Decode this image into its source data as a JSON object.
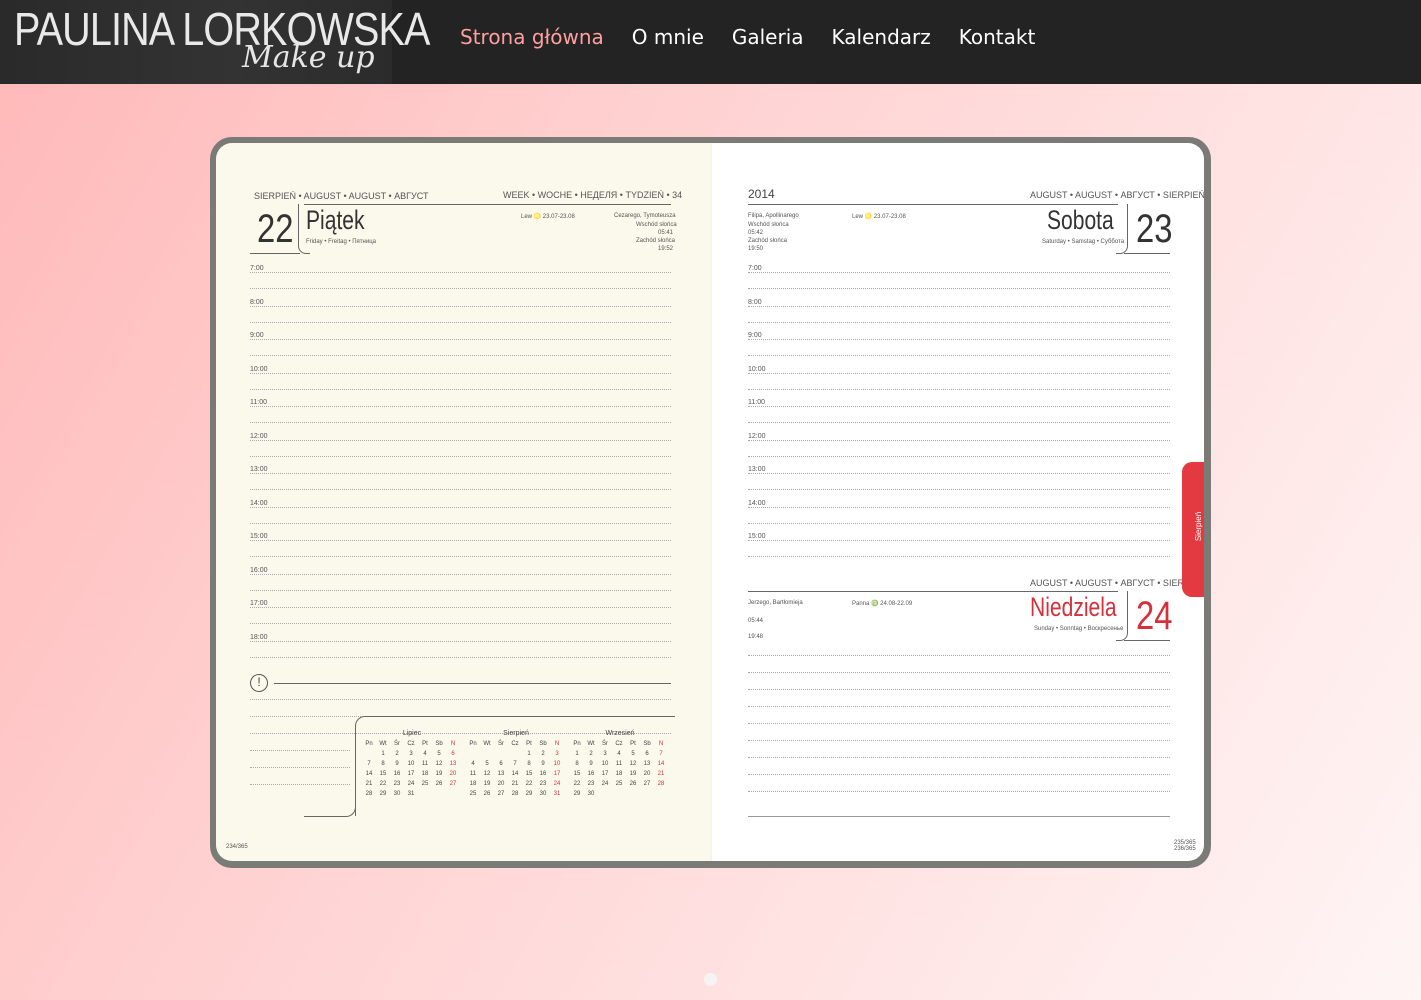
{
  "header": {
    "logo_name": "PAULINA LORKOWSKA",
    "logo_sub": "Make up",
    "nav": [
      {
        "label": "Strona główna",
        "active": true
      },
      {
        "label": "O mnie"
      },
      {
        "label": "Galeria"
      },
      {
        "label": "Kalendarz"
      },
      {
        "label": "Kontakt"
      }
    ]
  },
  "slider": {
    "active_color": "#ff9f9f",
    "image": {
      "left_page": {
        "month_header": "SIERPIEŃ • AUGUST • AUGUST • АВГУСТ",
        "week_header": "WEEK • WOCHE • НЕДЕЛЯ • TYDZIEŃ • 34",
        "day_number": "22",
        "day_name": "Piątek",
        "day_translations": "Friday • Freitag • Пятница",
        "names": "Cezarego, Tymoteusza",
        "sunrise_label": "Wschód słońca",
        "sunrise": "05:41",
        "sunset_label": "Zachód słońca",
        "sunset": "19:52",
        "zodiac": "Lew ♌ 23.07-23.08",
        "hours": [
          "7:00",
          "8:00",
          "9:00",
          "10:00",
          "11:00",
          "12:00",
          "13:00",
          "14:00",
          "15:00",
          "16:00",
          "17:00",
          "18:00"
        ],
        "page_counter": "234/365",
        "mini_calendars": [
          {
            "title": "Lipiec",
            "head": [
              "Pn",
              "Wt",
              "Śr",
              "Cz",
              "Pt",
              "Sb",
              "N"
            ],
            "days": [
              "",
              "1",
              "2",
              "3",
              "4",
              "5",
              "6",
              "7",
              "8",
              "9",
              "10",
              "11",
              "12",
              "13",
              "14",
              "15",
              "16",
              "17",
              "18",
              "19",
              "20",
              "21",
              "22",
              "23",
              "24",
              "25",
              "26",
              "27",
              "28",
              "29",
              "30",
              "31",
              "",
              "",
              ""
            ]
          },
          {
            "title": "Sierpień",
            "head": [
              "Pn",
              "Wt",
              "Śr",
              "Cz",
              "Pt",
              "Sb",
              "N"
            ],
            "days": [
              "",
              "",
              "",
              "",
              "1",
              "2",
              "3",
              "4",
              "5",
              "6",
              "7",
              "8",
              "9",
              "10",
              "11",
              "12",
              "13",
              "14",
              "15",
              "16",
              "17",
              "18",
              "19",
              "20",
              "21",
              "22",
              "23",
              "24",
              "25",
              "26",
              "27",
              "28",
              "29",
              "30",
              "31"
            ]
          },
          {
            "title": "Wrzesień",
            "head": [
              "Pn",
              "Wt",
              "Śr",
              "Cz",
              "Pt",
              "Sb",
              "N"
            ],
            "days": [
              "1",
              "2",
              "3",
              "4",
              "5",
              "6",
              "7",
              "8",
              "9",
              "10",
              "11",
              "12",
              "13",
              "14",
              "15",
              "16",
              "17",
              "18",
              "19",
              "20",
              "21",
              "22",
              "23",
              "24",
              "25",
              "26",
              "27",
              "28",
              "29",
              "30",
              "",
              "",
              "",
              "",
              ""
            ]
          }
        ]
      },
      "right_page": {
        "year": "2014",
        "month_header": "AUGUST • AUGUST • АВГУСТ • SIERPIEŃ",
        "day_number": "23",
        "day_name": "Sobota",
        "day_translations": "Saturday • Samstag • Суббота",
        "names": "Filipa, Apollinarego",
        "sunrise_label": "Wschód słońca",
        "sunrise": "05:42",
        "sunset_label": "Zachód słońca",
        "sunset": "19:50",
        "zodiac": "Lew ♌ 23.07-23.08",
        "hours": [
          "7:00",
          "8:00",
          "9:00",
          "10:00",
          "11:00",
          "12:00",
          "13:00",
          "14:00",
          "15:00"
        ],
        "second_header": "AUGUST • AUGUST • АВГУСТ • SIERPIEŃ",
        "sunday_number": "24",
        "sunday_name": "Niedziela",
        "sunday_translations": "Sunday • Sonntag • Воскресенье",
        "sunday_names": "Jerzego, Bartłomieja",
        "sunday_sunrise": "05:44",
        "sunday_sunset": "19:48",
        "sunday_zodiac": "Panna ♍ 24.08-22.09",
        "tab_label": "Sierpień",
        "page_counter": "235/365 236/365",
        "sunday_color": "#d6303a"
      }
    }
  }
}
